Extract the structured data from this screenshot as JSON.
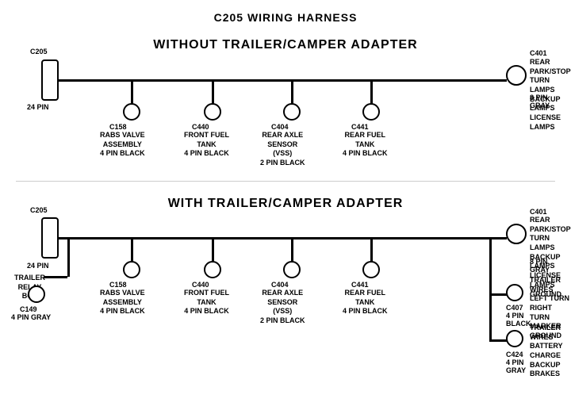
{
  "page": {
    "title": "C205 WIRING HARNESS"
  },
  "top_section": {
    "label": "WITHOUT TRAILER/CAMPER ADAPTER",
    "left_connector": {
      "id": "C205",
      "pin_label": "24 PIN"
    },
    "right_connector": {
      "id": "C401",
      "pin_label": "8 PIN",
      "color": "GRAY",
      "description": "REAR PARK/STOP\nTURN LAMPS\nBACKUP LAMPS\nLICENSE LAMPS"
    },
    "sub_connectors": [
      {
        "id": "C158",
        "desc": "RABS VALVE\nASSEMBLY\n4 PIN BLACK"
      },
      {
        "id": "C440",
        "desc": "FRONT FUEL\nTANK\n4 PIN BLACK"
      },
      {
        "id": "C404",
        "desc": "REAR AXLE\nSENSOR\n(VSS)\n2 PIN BLACK"
      },
      {
        "id": "C441",
        "desc": "REAR FUEL\nTANK\n4 PIN BLACK"
      }
    ]
  },
  "bottom_section": {
    "label": "WITH TRAILER/CAMPER ADAPTER",
    "left_connector": {
      "id": "C205",
      "pin_label": "24 PIN"
    },
    "trailer_relay": {
      "label": "TRAILER\nRELAY\nBOX"
    },
    "c149": {
      "id": "C149",
      "desc": "4 PIN GRAY"
    },
    "right_connector": {
      "id": "C401",
      "pin_label": "8 PIN",
      "color": "GRAY",
      "description": "REAR PARK/STOP\nTURN LAMPS\nBACKUP LAMPS\nLICENSE LAMPS\nGROUND"
    },
    "sub_connectors": [
      {
        "id": "C158",
        "desc": "RABS VALVE\nASSEMBLY\n4 PIN BLACK"
      },
      {
        "id": "C440",
        "desc": "FRONT FUEL\nTANK\n4 PIN BLACK"
      },
      {
        "id": "C404",
        "desc": "REAR AXLE\nSENSOR\n(VSS)\n2 PIN BLACK"
      },
      {
        "id": "C441",
        "desc": "REAR FUEL\nTANK\n4 PIN BLACK"
      }
    ],
    "c407": {
      "id": "C407",
      "desc": "4 PIN\nBLACK",
      "wires": "TRAILER WIRES\nLEFT TURN\nRIGHT TURN\nMARKER\nGROUND"
    },
    "c424": {
      "id": "C424",
      "desc": "4 PIN\nGRAY",
      "wires": "TRAILER WIRES\nBATTERY CHARGE\nBACKUP\nBRAKES"
    }
  }
}
